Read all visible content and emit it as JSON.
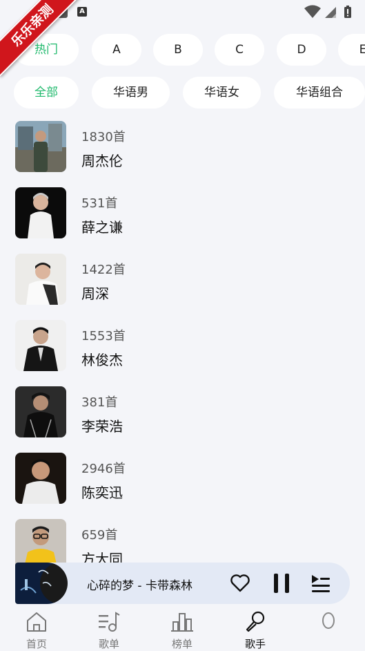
{
  "ribbon_text": "乐乐亲测",
  "letter_chips": [
    {
      "label": "热门",
      "active": true
    },
    {
      "label": "A",
      "active": false
    },
    {
      "label": "B",
      "active": false
    },
    {
      "label": "C",
      "active": false
    },
    {
      "label": "D",
      "active": false
    },
    {
      "label": "E",
      "active": false
    }
  ],
  "category_chips": [
    {
      "label": "全部",
      "active": true
    },
    {
      "label": "华语男",
      "active": false
    },
    {
      "label": "华语女",
      "active": false
    },
    {
      "label": "华语组合",
      "active": false
    }
  ],
  "artists": [
    {
      "count": "1830首",
      "name": "周杰伦"
    },
    {
      "count": "531首",
      "name": "薛之谦"
    },
    {
      "count": "1422首",
      "name": "周深"
    },
    {
      "count": "1553首",
      "name": "林俊杰"
    },
    {
      "count": "381首",
      "name": "李荣浩"
    },
    {
      "count": "2946首",
      "name": "陈奕迅"
    },
    {
      "count": "659首",
      "name": "方大同"
    }
  ],
  "player": {
    "song": "心碎的梦 - 卡带森林",
    "icons": [
      "heart-icon",
      "pause-icon",
      "queue-icon"
    ]
  },
  "tabs": [
    {
      "label": "首页",
      "icon": "home-icon",
      "active": false
    },
    {
      "label": "歌单",
      "icon": "playlist-icon",
      "active": false
    },
    {
      "label": "榜单",
      "icon": "chart-icon",
      "active": false
    },
    {
      "label": "歌手",
      "icon": "microphone-icon",
      "active": true
    },
    {
      "label": "",
      "icon": "profile-icon",
      "active": false
    }
  ],
  "colors": {
    "accent": "#1fb96c",
    "background": "#f4f5f9",
    "chip": "#ffffff",
    "player": "#e3e9f5",
    "ribbon": "#d0161c"
  }
}
